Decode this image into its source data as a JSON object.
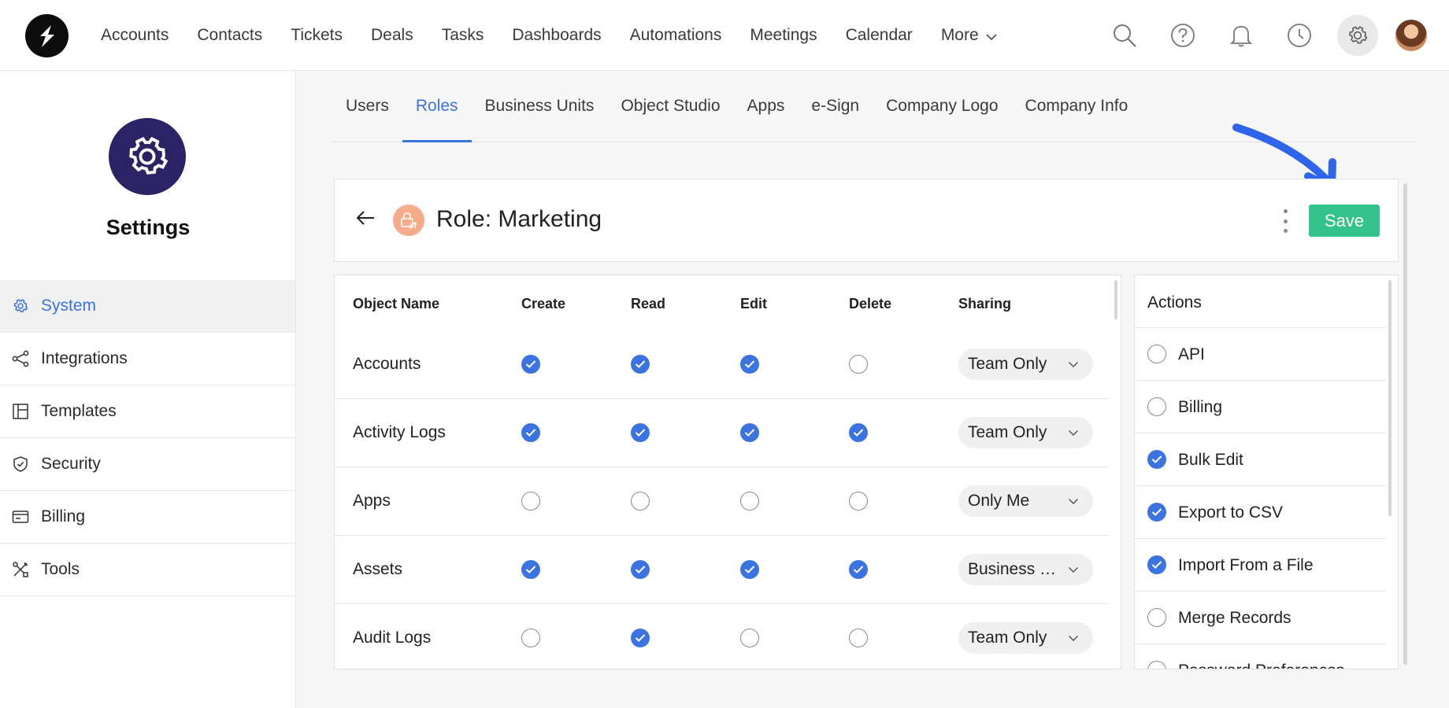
{
  "topnav": {
    "items": [
      "Accounts",
      "Contacts",
      "Tickets",
      "Deals",
      "Tasks",
      "Dashboards",
      "Automations",
      "Meetings",
      "Calendar"
    ],
    "more_label": "More",
    "icons": [
      "search-icon",
      "help-icon",
      "bell-icon",
      "clock-icon",
      "gear-icon"
    ]
  },
  "sidebar": {
    "title": "Settings",
    "items": [
      {
        "label": "System",
        "icon": "gear-icon",
        "active": true
      },
      {
        "label": "Integrations",
        "icon": "share-icon"
      },
      {
        "label": "Templates",
        "icon": "layout-icon"
      },
      {
        "label": "Security",
        "icon": "shield-icon"
      },
      {
        "label": "Billing",
        "icon": "card-icon"
      },
      {
        "label": "Tools",
        "icon": "tools-icon"
      }
    ]
  },
  "tabs": [
    {
      "label": "Users"
    },
    {
      "label": "Roles",
      "active": true
    },
    {
      "label": "Business Units"
    },
    {
      "label": "Object Studio"
    },
    {
      "label": "Apps"
    },
    {
      "label": "e-Sign"
    },
    {
      "label": "Company Logo"
    },
    {
      "label": "Company Info"
    }
  ],
  "role": {
    "title": "Role: Marketing",
    "save_label": "Save"
  },
  "permissions": {
    "headers": {
      "object_name": "Object Name",
      "create": "Create",
      "read": "Read",
      "edit": "Edit",
      "delete": "Delete",
      "sharing": "Sharing"
    },
    "rows": [
      {
        "name": "Accounts",
        "create": true,
        "read": true,
        "edit": true,
        "delete": false,
        "sharing": "Team Only"
      },
      {
        "name": "Activity Logs",
        "create": true,
        "read": true,
        "edit": true,
        "delete": true,
        "sharing": "Team Only"
      },
      {
        "name": "Apps",
        "create": false,
        "read": false,
        "edit": false,
        "delete": false,
        "sharing": "Only Me"
      },
      {
        "name": "Assets",
        "create": true,
        "read": true,
        "edit": true,
        "delete": true,
        "sharing": "Business Units"
      },
      {
        "name": "Audit Logs",
        "create": false,
        "read": true,
        "edit": false,
        "delete": false,
        "sharing": "Team Only"
      }
    ]
  },
  "actions": {
    "title": "Actions",
    "items": [
      {
        "label": "API",
        "checked": false
      },
      {
        "label": "Billing",
        "checked": false
      },
      {
        "label": "Bulk Edit",
        "checked": true
      },
      {
        "label": "Export to CSV",
        "checked": true
      },
      {
        "label": "Import From a File",
        "checked": true
      },
      {
        "label": "Merge Records",
        "checked": false
      },
      {
        "label": "Password Preferences",
        "checked": false
      }
    ]
  },
  "colors": {
    "accent": "#3b74e0",
    "save": "#34c48b",
    "settings_badge": "#2a2466",
    "role_icon": "#f6ab8a"
  }
}
